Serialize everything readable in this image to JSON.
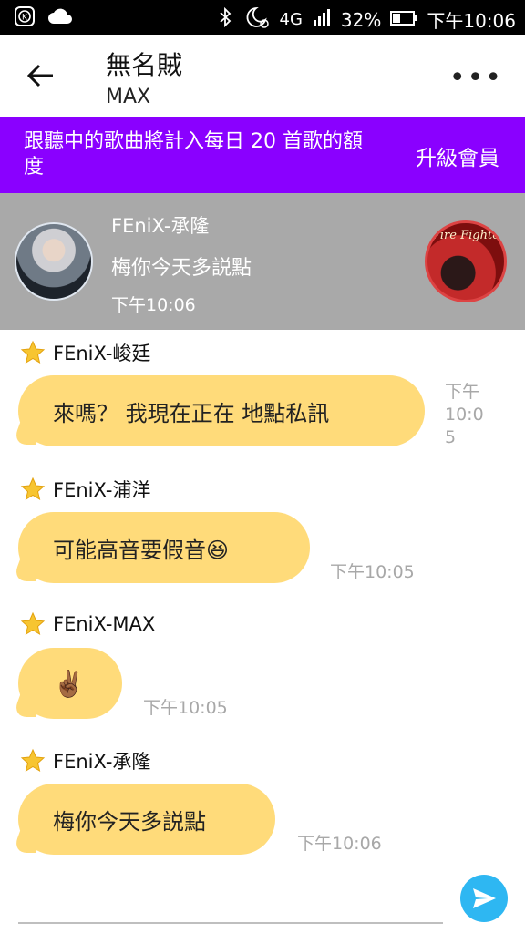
{
  "status_bar": {
    "battery": "32%",
    "time": "下午10:06",
    "network": "4G"
  },
  "header": {
    "title": "無名賊",
    "subtitle": "MAX"
  },
  "banner": {
    "text": "跟聽中的歌曲將計入每日 20 首歌的額度",
    "button": "升級會員"
  },
  "now_playing": {
    "name": "FEniX-承隆",
    "message": "梅你今天多説點",
    "time": "下午10:06",
    "album_title": "Fire Fighter"
  },
  "messages": [
    {
      "sender": "FEniX-峻廷",
      "text": "來嗎？ 我現在正在 地點私訊",
      "time_lines": [
        "下午",
        "10:0",
        "5"
      ]
    },
    {
      "sender": "FEniX-浦洋",
      "text": "可能高音要假音😆",
      "time": "下午10:05"
    },
    {
      "sender": "FEniX-MAX",
      "text": "✌🏾",
      "time": "下午10:05"
    },
    {
      "sender": "FEniX-承隆",
      "text": "梅你今天多説點",
      "time": "下午10:06"
    }
  ],
  "colors": {
    "banner_bg": "#8a00ff",
    "bubble_bg": "#ffdb7a",
    "send_button": "#2eb7f2",
    "now_playing_bg": "#a9a9a9"
  }
}
